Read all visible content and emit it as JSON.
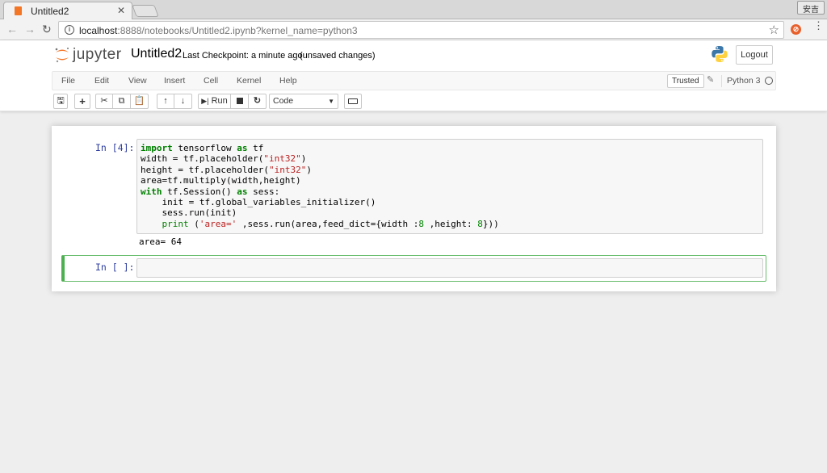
{
  "browser": {
    "tab_title": "Untitled2",
    "tab_close": "✕",
    "profile_label": "安吉",
    "url_host": "localhost",
    "url_rest": ":8888/notebooks/Untitled2.ipynb?kernel_name=python3"
  },
  "header": {
    "logo_text": "jupyter",
    "notebook_name": "Untitled2",
    "checkpoint": "Last Checkpoint: a minute ago",
    "autosave": "(unsaved changes)",
    "logout_label": "Logout"
  },
  "menubar": {
    "items": [
      "File",
      "Edit",
      "View",
      "Insert",
      "Cell",
      "Kernel",
      "Help"
    ],
    "trusted_label": "Trusted",
    "kernel_name": "Python 3"
  },
  "toolbar": {
    "run_label": "Run",
    "cell_type": "Code"
  },
  "cells": [
    {
      "prompt": "In [4]:",
      "output": "area= 64"
    },
    {
      "prompt": "In [ ]:"
    }
  ],
  "icons": {
    "save": "save-icon",
    "add": "plus-icon",
    "cut": "scissors-icon",
    "copy": "copy-icon",
    "paste": "paste-icon",
    "up": "arrow-up-icon",
    "down": "arrow-down-icon",
    "run": "step-forward-icon",
    "stop": "stop-icon",
    "restart": "refresh-icon",
    "keyboard": "keyboard-icon"
  },
  "colors": {
    "jupyter_orange": "#f37626",
    "prompt_blue": "#303f9f",
    "edit_green": "#66bb6a"
  }
}
